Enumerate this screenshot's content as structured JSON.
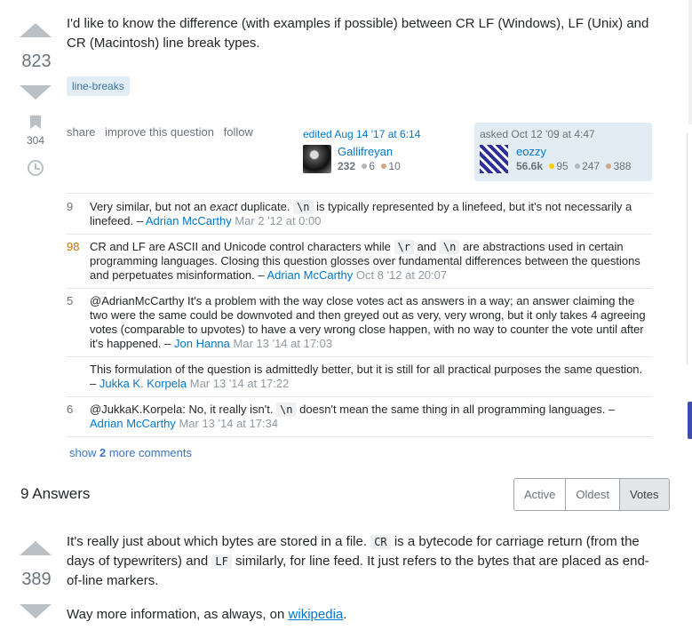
{
  "question": {
    "votes": "823",
    "bookmarks": "304",
    "body": "I'd like to know the difference (with examples if possible) between CR LF (Windows), LF (Unix) and CR (Macintosh) line break types.",
    "tags": [
      "line-breaks"
    ],
    "menu": {
      "share": "share",
      "improve": "improve this question",
      "follow": "follow"
    },
    "editor": {
      "action": "edited Aug 14 '17 at 6:14",
      "name": "Gallifreyan",
      "rep": "232",
      "silver": "6",
      "bronze": "10"
    },
    "owner": {
      "action": "asked Oct 12 '09 at 4:47",
      "name": "eozzy",
      "rep": "56.6k",
      "gold": "95",
      "silver": "247",
      "bronze": "388"
    }
  },
  "comments": [
    {
      "score": "9",
      "pre": "Very similar, but not an ",
      "em": "exact",
      "mid": " duplicate. ",
      "code1": "\\n",
      "post": " is typically represented by a linefeed, but it's not necessarily a linefeed. – ",
      "user": "Adrian McCarthy",
      "date": "Mar 2 '12 at 0:00"
    },
    {
      "score": "98",
      "pre": "CR and LF are ASCII and Unicode control characters while ",
      "code1": "\\r",
      "mid": " and ",
      "code2": "\\n",
      "post": " are abstractions used in certain programming languages. Closing this question glosses over fundamental differences between the questions and perpetuates misinformation. – ",
      "user": "Adrian McCarthy",
      "date": "Oct 8 '12 at 20:07"
    },
    {
      "score": "5",
      "pre": "@AdrianMcCarthy It's a problem with the way close votes act as answers in a way; an answer claiming the two were the same could be downvoted and then greyed out as very, very wrong, but it only takes 4 agreeing votes (comparable to upvotes) to have a very wrong close happen, with no way to counter the vote until after it's happened. – ",
      "user": "Jon Hanna",
      "date": "Mar 13 '14 at 17:03"
    },
    {
      "score": "",
      "pre": "This formulation of the question is admittedly better, but it is still for all practical purposes the same question. – ",
      "user": "Jukka K. Korpela",
      "date": "Mar 13 '14 at 17:22"
    },
    {
      "score": "6",
      "pre": "@JukkaK.Korpela: No, it really isn't. ",
      "code1": "\\n",
      "post": " doesn't mean the same thing in all programming languages. – ",
      "user": "Adrian McCarthy",
      "date": "Mar 13 '14 at 17:34"
    }
  ],
  "show_more": {
    "pre": "show ",
    "count": "2",
    "post": " more comments"
  },
  "answers": {
    "count_label": "9 Answers",
    "tabs": [
      "Active",
      "Oldest",
      "Votes"
    ],
    "active_tab": "Votes",
    "first": {
      "votes": "389",
      "p1_a": "It's really just about which bytes are stored in a file. ",
      "p1_code1": "CR",
      "p1_b": " is a bytecode for carriage return (from the days of typewriters) and ",
      "p1_code2": "LF",
      "p1_c": " similarly, for line feed. It just refers to the bytes that are placed as end-of-line markers.",
      "p2_a": "Way more information, as always, on ",
      "p2_link": "wikipedia",
      "p2_b": "."
    }
  },
  "colors": {
    "link": "#0077cc",
    "tag_bg": "#e1ecf4",
    "gold": "#ffcc01",
    "silver": "#b4b8bc",
    "bronze": "#d1a684",
    "hot_score": "#c96b00"
  }
}
